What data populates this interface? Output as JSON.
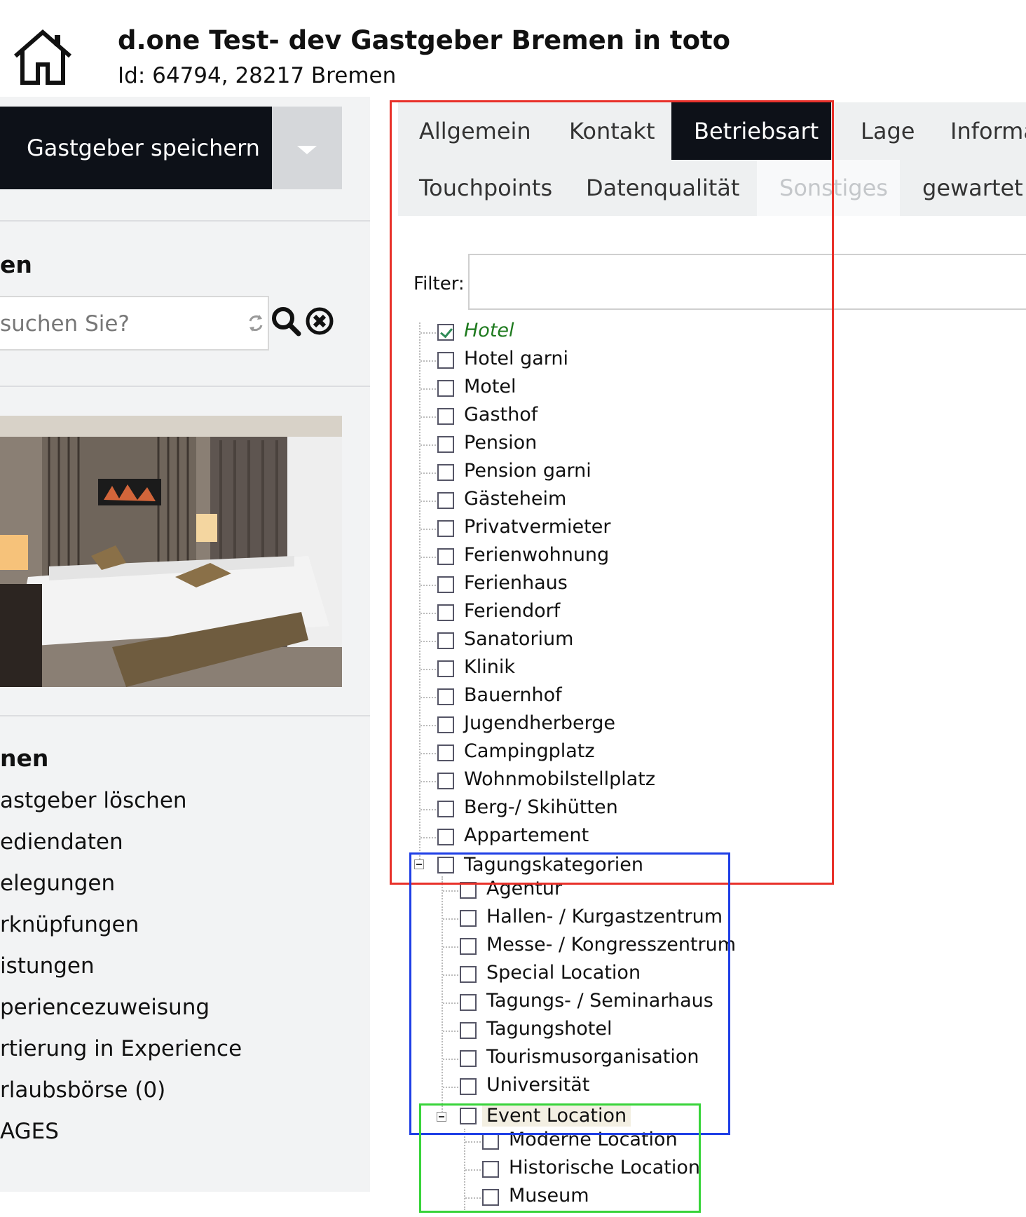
{
  "header": {
    "title": "d.one Test- dev Gastgeber Bremen in toto",
    "subtitle": "Id: 64794, 28217 Bremen"
  },
  "sidebar": {
    "save_label": "Gastgeber speichern",
    "search_heading": "en",
    "search_placeholder": "suchen Sie?",
    "actions_heading": "nen",
    "actions": [
      "astgeber löschen",
      "ediendaten",
      "elegungen",
      "rknüpfungen",
      "istungen",
      "periencezuweisung",
      "rtierung in Experience",
      "rlaubsbörse (0)",
      "AGES"
    ]
  },
  "tabs": {
    "row1": [
      "Allgemein",
      "Kontakt",
      "Betriebsart",
      "Lage",
      "Informa"
    ],
    "row2": [
      "Touchpoints",
      "Datenqualität",
      "Sonstiges",
      "gewartet o"
    ],
    "active": "Betriebsart"
  },
  "filter": {
    "label": "Filter:",
    "value": ""
  },
  "tree": {
    "top_items": [
      {
        "label": "Hotel",
        "checked": true
      },
      {
        "label": "Hotel garni",
        "checked": false
      },
      {
        "label": "Motel",
        "checked": false
      },
      {
        "label": "Gasthof",
        "checked": false
      },
      {
        "label": "Pension",
        "checked": false
      },
      {
        "label": "Pension garni",
        "checked": false
      },
      {
        "label": "Gästeheim",
        "checked": false
      },
      {
        "label": "Privatvermieter",
        "checked": false
      },
      {
        "label": "Ferienwohnung",
        "checked": false
      },
      {
        "label": "Ferienhaus",
        "checked": false
      },
      {
        "label": "Feriendorf",
        "checked": false
      },
      {
        "label": "Sanatorium",
        "checked": false
      },
      {
        "label": "Klinik",
        "checked": false
      },
      {
        "label": "Bauernhof",
        "checked": false
      },
      {
        "label": "Jugendherberge",
        "checked": false
      },
      {
        "label": "Campingplatz",
        "checked": false
      },
      {
        "label": "Wohnmobilstellplatz",
        "checked": false
      },
      {
        "label": "Berg-/ Skihütten",
        "checked": false
      },
      {
        "label": "Appartement",
        "checked": false
      }
    ],
    "tagung_label": "Tagungskategorien",
    "tagung_items": [
      "Agentur",
      "Hallen- / Kurgastzentrum",
      "Messe- / Kongresszentrum",
      "Special Location",
      "Tagungs- / Seminarhaus",
      "Tagungshotel",
      "Tourismusorganisation",
      "Universität"
    ],
    "event_label": "Event Location",
    "event_items": [
      "Moderne Location",
      "Historische Location",
      "Museum"
    ]
  },
  "colors": {
    "red_box": "#e8312a",
    "blue_box": "#1f3fe6",
    "green_box": "#38d43a",
    "dark": "#0d1118"
  }
}
